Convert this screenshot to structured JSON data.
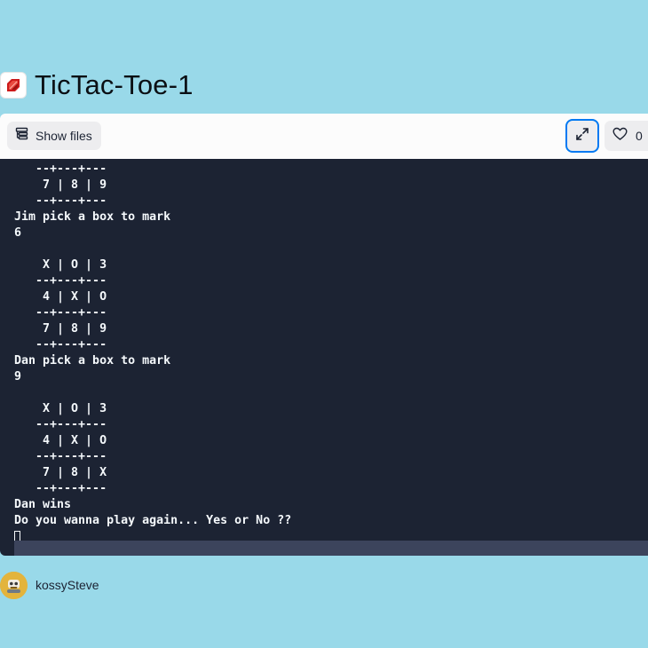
{
  "header": {
    "title": "TicTac-Toe-1",
    "language_icon": "ruby-icon"
  },
  "toolbar": {
    "show_files_label": "Show files",
    "expand_icon": "expand-icon",
    "like_count": "0"
  },
  "terminal": {
    "background": "#1c2333",
    "text_color": "#f5f9fc",
    "lines": [
      "   --+---+---",
      "    7 | 8 | 9",
      "   --+---+---",
      "Jim pick a box to mark",
      "6",
      "",
      "    X | O | 3",
      "   --+---+---",
      "    4 | X | O",
      "   --+---+---",
      "    7 | 8 | 9",
      "   --+---+---",
      "Dan pick a box to mark",
      "9",
      "",
      "    X | O | 3",
      "   --+---+---",
      "    4 | X | O",
      "   --+---+---",
      "    7 | 8 | X",
      "   --+---+---",
      "Dan wins",
      "Do you wanna play again... Yes or No ??"
    ]
  },
  "author": {
    "name": "kossySteve"
  },
  "colors": {
    "page_background": "#99d9e9",
    "accent": "#0079f2",
    "ruby": "#cc1a1a"
  }
}
